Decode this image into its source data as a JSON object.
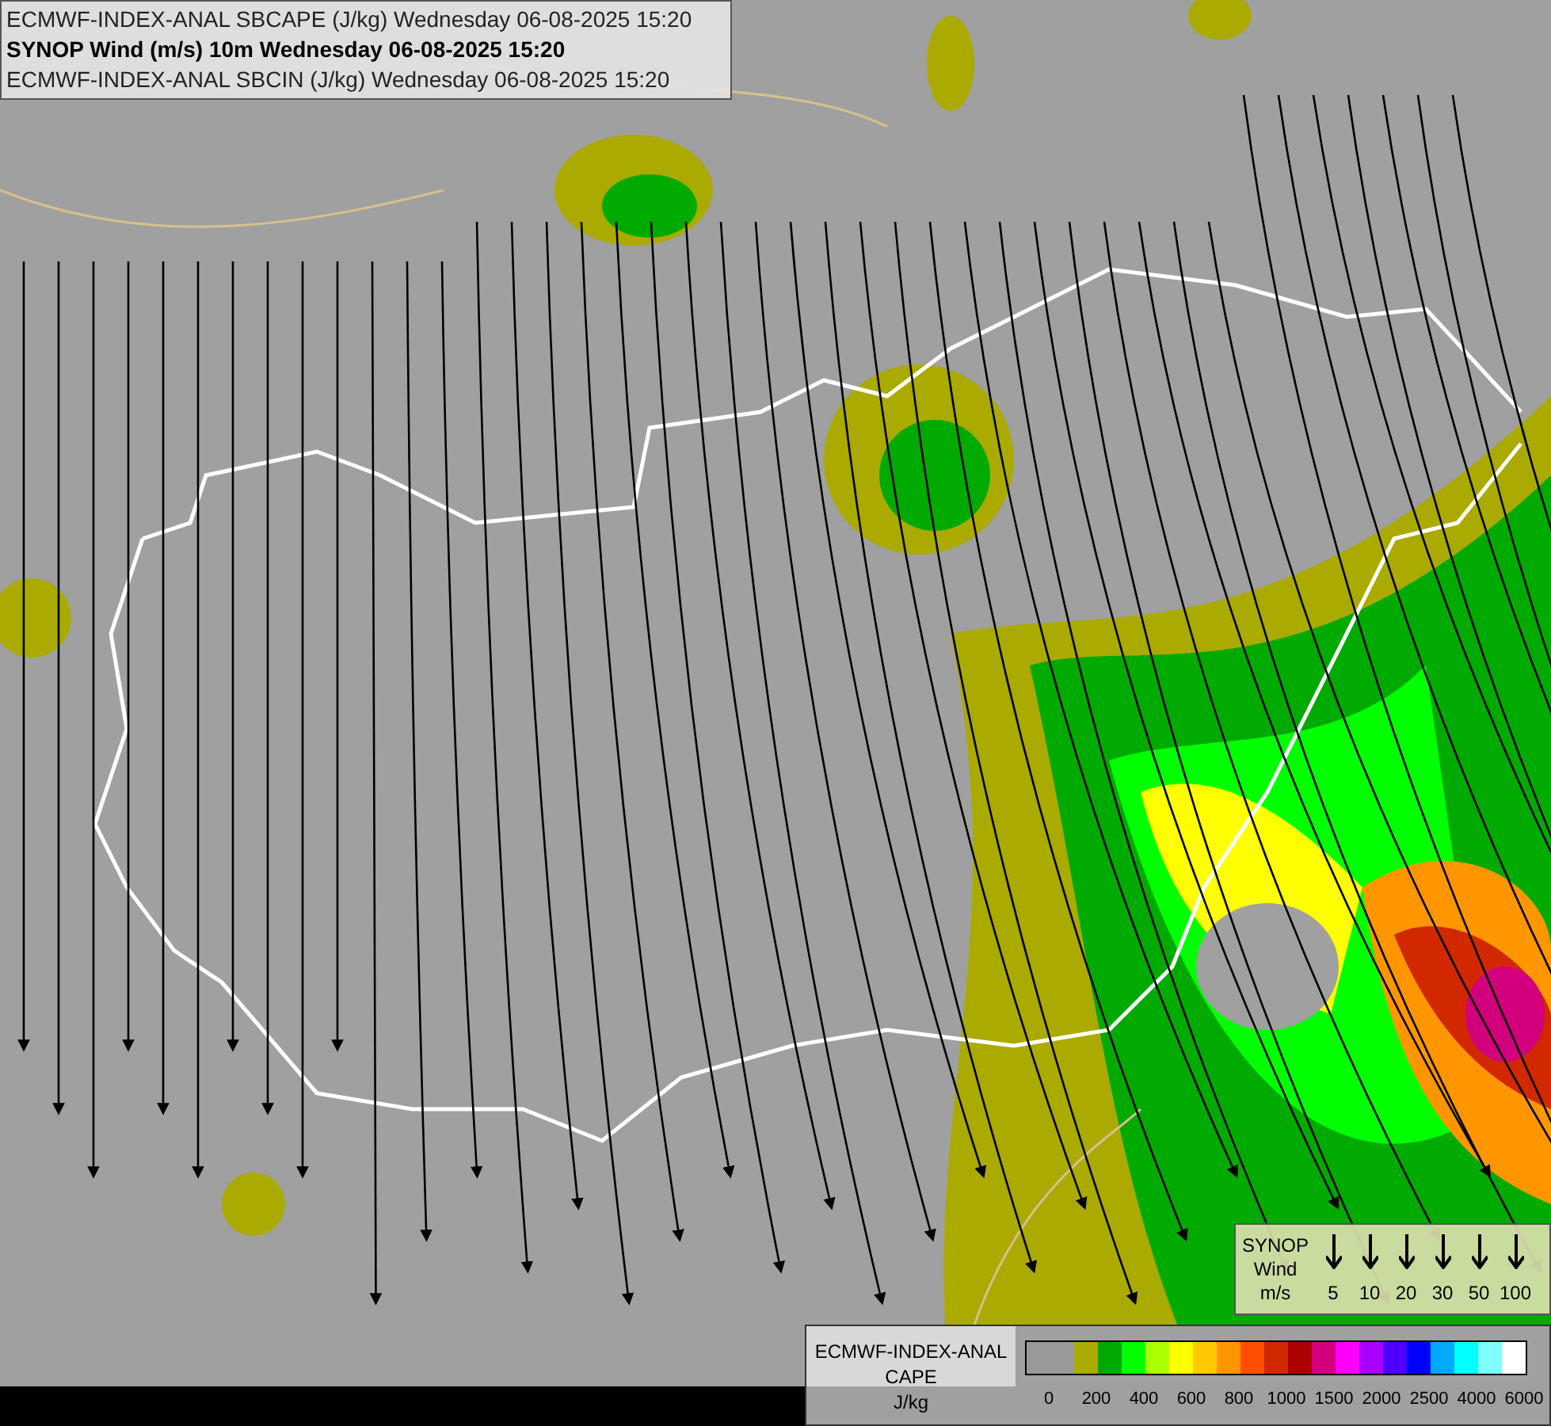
{
  "title_lines": [
    {
      "text": "ECMWF-INDEX-ANAL SBCAPE (J/kg) Wednesday 06-08-2025 15:20",
      "bold": false
    },
    {
      "text": "SYNOP Wind (m/s) 10m Wednesday 06-08-2025 15:20",
      "bold": true
    },
    {
      "text": "ECMWF-INDEX-ANAL SBCIN (J/kg) Wednesday 06-08-2025 15:20",
      "bold": false
    }
  ],
  "wind_legend": {
    "label_lines": [
      "SYNOP",
      "Wind",
      "m/s"
    ],
    "speeds": [
      "5",
      "10",
      "20",
      "30",
      "50",
      "100"
    ]
  },
  "cape_legend": {
    "label_lines": [
      "ECMWF-INDEX-ANAL",
      "CAPE",
      "J/kg"
    ],
    "swatches": [
      {
        "color": "#999999"
      },
      {
        "color": "#999999"
      },
      {
        "color": "#aaaa00"
      },
      {
        "color": "#00aa00"
      },
      {
        "color": "#00ff00"
      },
      {
        "color": "#aaff00"
      },
      {
        "color": "#ffff00"
      },
      {
        "color": "#ffc800"
      },
      {
        "color": "#ff9600"
      },
      {
        "color": "#ff5000"
      },
      {
        "color": "#d22800"
      },
      {
        "color": "#aa0000"
      },
      {
        "color": "#d2007d"
      },
      {
        "color": "#ff00ff"
      },
      {
        "color": "#aa00ff"
      },
      {
        "color": "#5000ff"
      },
      {
        "color": "#0000ff"
      },
      {
        "color": "#00aaff"
      },
      {
        "color": "#00ffff"
      },
      {
        "color": "#80ffff"
      },
      {
        "color": "#ffffff"
      }
    ],
    "ticks": [
      "0",
      "200",
      "400",
      "600",
      "800",
      "1000",
      "1500",
      "2000",
      "2500",
      "4000",
      "6000"
    ]
  }
}
